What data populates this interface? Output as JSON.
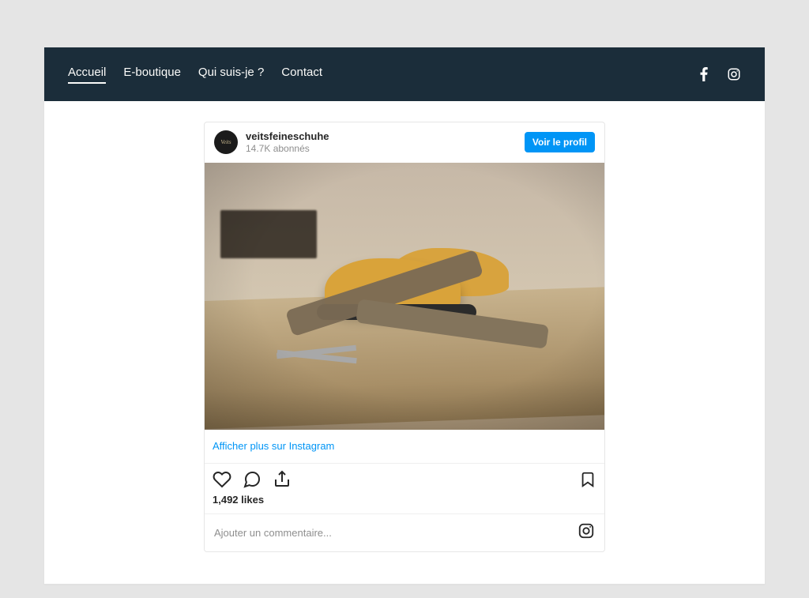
{
  "nav": {
    "items": [
      {
        "label": "Accueil",
        "active": true
      },
      {
        "label": "E-boutique",
        "active": false
      },
      {
        "label": "Qui suis-je ?",
        "active": false
      },
      {
        "label": "Contact",
        "active": false
      }
    ],
    "social": {
      "facebook": "facebook-icon",
      "instagram": "instagram-icon"
    }
  },
  "embed": {
    "username": "veitsfeineschuhe",
    "avatar_text": "Veits",
    "followers_text": "14.7K abonnés",
    "view_profile_label": "Voir le profil",
    "image_alt": "Shoe lasts and leather straps on a workbench",
    "show_more_label": "Afficher plus sur Instagram",
    "likes_text": "1,492 likes",
    "comment_placeholder": "Ajouter un commentaire...",
    "icons": {
      "like": "heart-icon",
      "comment": "speech-bubble-icon",
      "share": "share-icon",
      "save": "bookmark-icon",
      "footer_brand": "instagram-icon"
    }
  },
  "colors": {
    "page_bg": "#e5e5e5",
    "nav_bg": "#1b2d3a",
    "nav_text": "#fbfbf9",
    "accent": "#0095f6",
    "text": "#262626",
    "muted": "#8e8e8e",
    "border": "#e6e6e6"
  }
}
